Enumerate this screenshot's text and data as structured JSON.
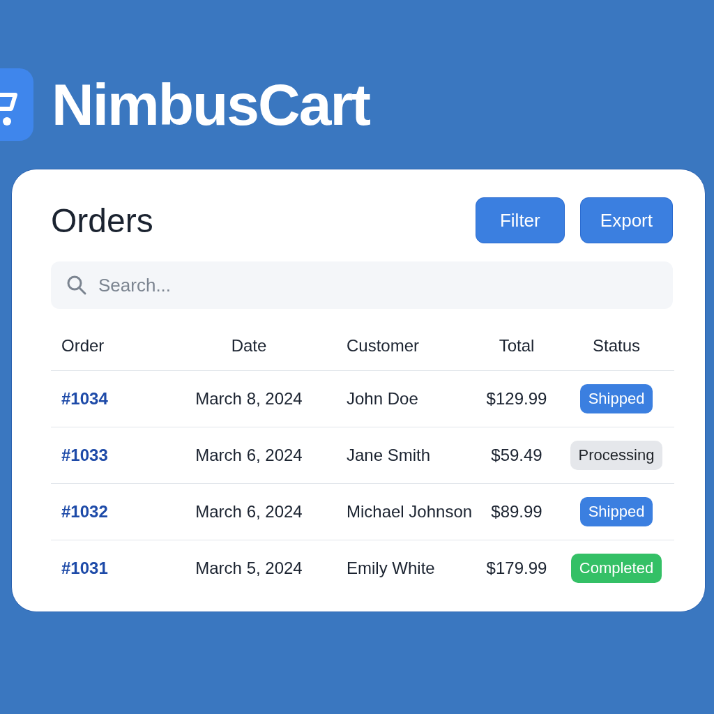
{
  "brand": {
    "name": "NimbusCart"
  },
  "header": {
    "title": "Orders",
    "buttons": [
      "Filter",
      "Export"
    ]
  },
  "search": {
    "placeholder": "Search..."
  },
  "table": {
    "columns": [
      "Order",
      "Date",
      "Customer",
      "Total",
      "Status"
    ],
    "rows": [
      {
        "order": "#1034",
        "date": "March 8, 2024",
        "customer": "John Doe",
        "total": "$129.99",
        "status": "Shipped",
        "color": "#3b7fe0"
      },
      {
        "order": "#1033",
        "date": "March 6, 2024",
        "customer": "Jane Smith",
        "total": "$59.49",
        "status": "Processing",
        "color": "#e5e7eb"
      },
      {
        "order": "#1032",
        "date": "March 6, 2024",
        "customer": "Michael Johnson",
        "total": "$89.99",
        "status": "Shipped",
        "color": "#3b7fe0"
      },
      {
        "order": "#1031",
        "date": "March 5, 2024",
        "customer": "Emily White",
        "total": "$179.99",
        "status": "Completed",
        "color": "#34c066"
      }
    ]
  }
}
